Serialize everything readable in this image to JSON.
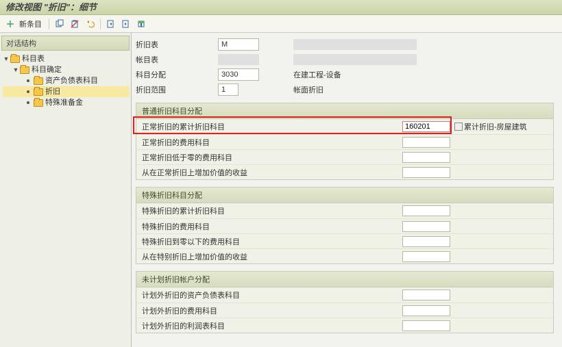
{
  "title": "修改视图 \"折旧\"：细节",
  "toolbar": {
    "new_entry": "新条目"
  },
  "sidebar": {
    "title": "对话结构",
    "tree": {
      "n0": "科目表",
      "n1": "科目确定",
      "n2": "资产负债表科目",
      "n3": "折旧",
      "n4": "特殊准备金"
    }
  },
  "header": {
    "l_table": "折旧表",
    "v_table": "M",
    "l_chart": "帐目表",
    "l_alloc": "科目分配",
    "v_alloc": "3030",
    "alloc_text": "在建工程-设备",
    "l_range": "折旧范围",
    "v_range": "1",
    "range_text": "帐面折旧"
  },
  "g1": {
    "title": "普通折旧科目分配",
    "r1": "正常折旧的累计折旧科目",
    "r1_val": "160201",
    "r1_text": "累计折旧-房屋建筑",
    "r2": "正常折旧的费用科目",
    "r3": "正常折旧低于零的费用科目",
    "r4": "从在正常折旧上增加价值的收益"
  },
  "g2": {
    "title": "特殊折旧科目分配",
    "r1": "特殊折旧的累计折旧科目",
    "r2": "特殊折旧的费用科目",
    "r3": "特殊折旧到零以下的费用科目",
    "r4": "从在特别折旧上增加价值的收益"
  },
  "g3": {
    "title": "未计划折旧帐户分配",
    "r1": "计划外折旧的资产负债表科目",
    "r2": "计划外折旧的费用科目",
    "r3": "计划外折旧的利润表科目"
  }
}
